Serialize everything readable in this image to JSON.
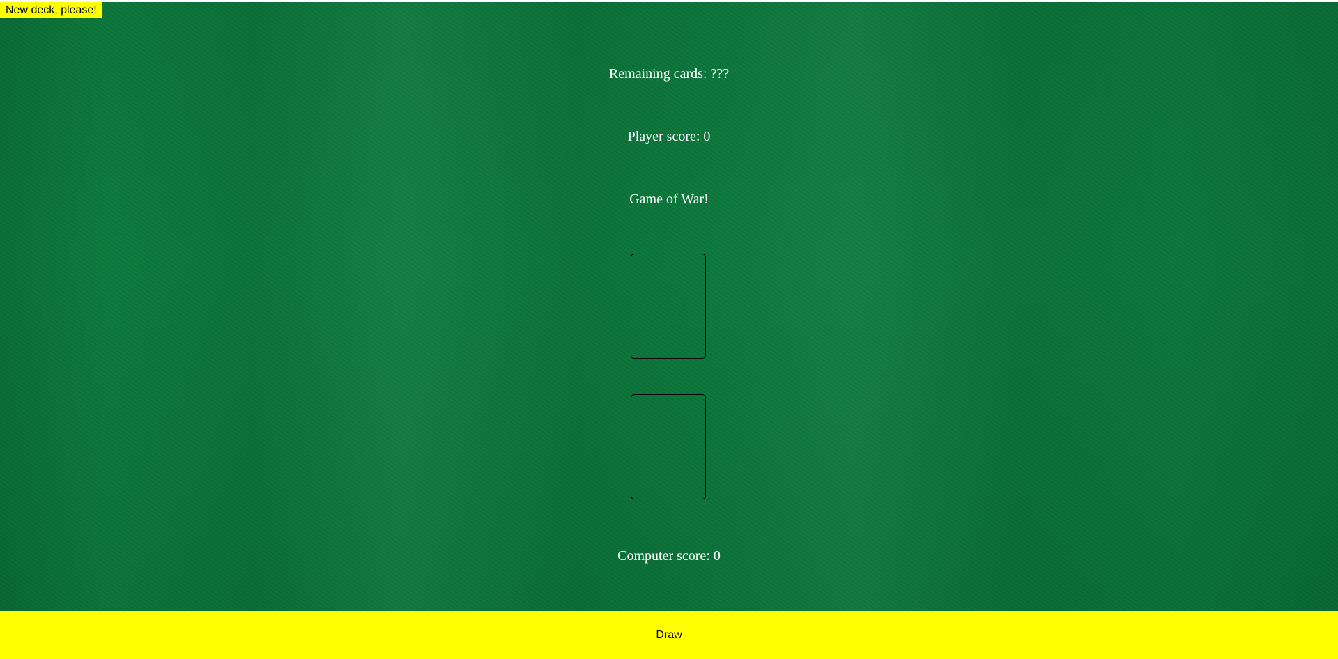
{
  "controls": {
    "new_deck_label": "New deck, please!",
    "draw_label": "Draw"
  },
  "stats": {
    "remaining_cards": "Remaining cards: ???",
    "player_score": "Player score: 0",
    "computer_score": "Computer score: 0"
  },
  "game": {
    "title": "Game of War!"
  },
  "colors": {
    "felt": "#0a7a3c",
    "button": "#ffff00",
    "text": "#ffffff"
  }
}
